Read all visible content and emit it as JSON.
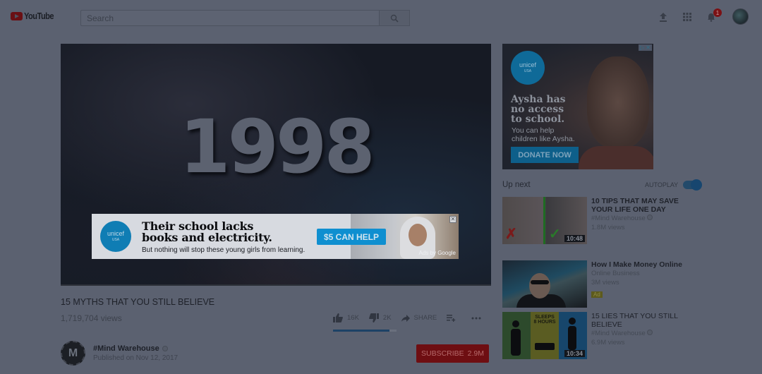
{
  "header": {
    "logo_text": "YouTube",
    "search_placeholder": "Search",
    "notification_count": "1",
    "icons": [
      "upload-icon",
      "apps-grid-icon",
      "notifications-bell-icon",
      "account-avatar"
    ]
  },
  "player": {
    "frame_text": "1998",
    "overlay_ad": {
      "brand": "unicef",
      "brand_sub": "USA",
      "headline_line1": "Their school lacks",
      "headline_line2": "books and electricity.",
      "subtext": "But nothing will stop these young girls from learning.",
      "cta": "$5 CAN HELP",
      "attribution": "Ads by Google",
      "close_symbol": "✕"
    }
  },
  "video": {
    "title": "15 MYTHS THAT YOU STILL BELIEVE",
    "views": "1,719,704 views",
    "likes": "16K",
    "dislikes": "2K",
    "share_label": "SHARE",
    "like_ratio_percent": 89,
    "channel": {
      "avatar_letter": "M",
      "name": "#Mind Warehouse",
      "published": "Published on Nov 12, 2017",
      "subscribe_label": "SUBSCRIBE",
      "subscriber_count": "2.9M"
    }
  },
  "sidebar_ad": {
    "brand": "unicef",
    "brand_sub": "USA",
    "headline_line1": "Aysha has",
    "headline_line2": "no access",
    "headline_line3": "to school.",
    "sub_line1": "You can help",
    "sub_line2": "children like Aysha.",
    "cta": "DONATE NOW",
    "adchoices": "▷",
    "close": "✕"
  },
  "up_next": {
    "label": "Up next",
    "autoplay_label": "AUTOPLAY",
    "autoplay_on": true
  },
  "recommendations": [
    {
      "title": "10 TIPS THAT MAY SAVE YOUR LIFE ONE DAY",
      "channel": "#Mind Warehouse",
      "verified": true,
      "views": "1.8M views",
      "duration": "10:48"
    },
    {
      "title": "How I Make Money Online",
      "channel": "Online Business",
      "verified": false,
      "views": "3M views",
      "badge": "Ad"
    },
    {
      "title": "15 LIES THAT YOU STILL BELIEVE",
      "channel": "#Mind Warehouse",
      "verified": true,
      "views": "6.9M views",
      "duration": "10:34",
      "thumb_text_line1": "SLEEPS",
      "thumb_text_line2": "8 HOURS"
    }
  ]
}
